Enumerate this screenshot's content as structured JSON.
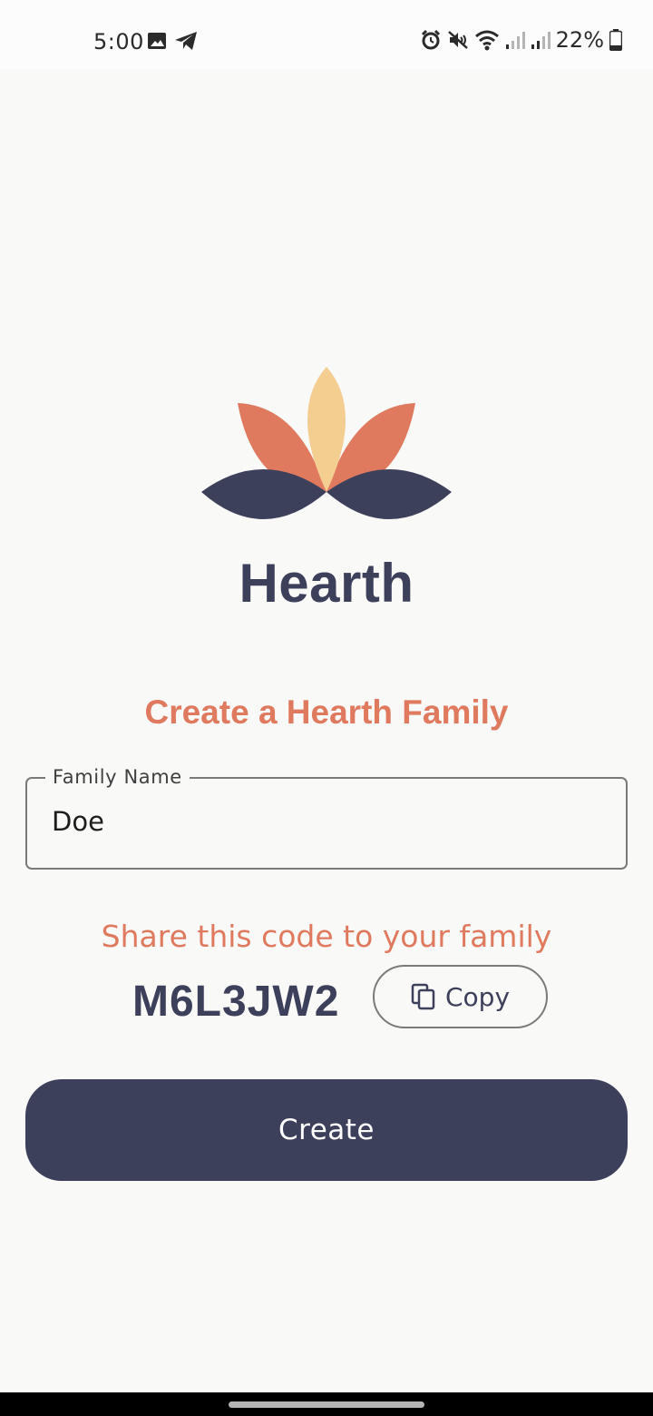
{
  "status_bar": {
    "time": "5:00",
    "battery": "22%",
    "left_icons": [
      "image-icon",
      "telegram-icon"
    ],
    "right_icons": [
      "alarm-icon",
      "mute-icon",
      "wifi-icon",
      "signal-icon",
      "signal-icon",
      "battery-icon"
    ]
  },
  "brand": {
    "name": "Hearth",
    "colors": {
      "navy": "#3d405b",
      "coral": "#e07a5f",
      "sand": "#f4cd91"
    }
  },
  "form": {
    "heading": "Create a Hearth Family",
    "family_name_label": "Family Name",
    "family_name_value": "Doe",
    "share_text": "Share this code to your family",
    "code": "M6L3JW2",
    "copy_label": "Copy",
    "create_label": "Create"
  }
}
